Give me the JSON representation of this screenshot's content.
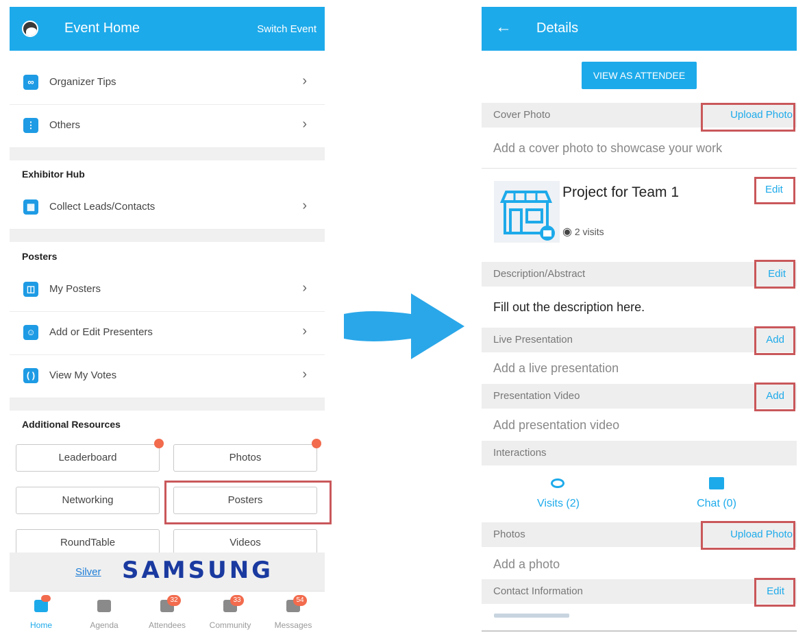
{
  "left": {
    "appbar": {
      "title": "Event Home",
      "switch": "Switch Event"
    },
    "menu_top": [
      {
        "label": "Organizer Tips",
        "icon": "glasses-icon"
      },
      {
        "label": "Others",
        "icon": "more-vertical-icon"
      }
    ],
    "exhibitor_hub": {
      "heading": "Exhibitor Hub",
      "items": [
        {
          "label": "Collect Leads/Contacts",
          "icon": "qr-code-icon"
        }
      ]
    },
    "posters": {
      "heading": "Posters",
      "items": [
        {
          "label": "My Posters",
          "icon": "poster-icon"
        },
        {
          "label": "Add or Edit Presenters",
          "icon": "presenters-icon"
        },
        {
          "label": "View My Votes",
          "icon": "laurel-icon"
        }
      ]
    },
    "resources": {
      "heading": "Additional Resources",
      "buttons": [
        "Leaderboard",
        "Photos",
        "Networking",
        "Posters",
        "RoundTable",
        "Videos"
      ]
    },
    "sponsor": {
      "tier": "Silver",
      "name": "SAMSUNG"
    },
    "tabs": [
      {
        "label": "Home",
        "badge": ""
      },
      {
        "label": "Agenda",
        "badge": ""
      },
      {
        "label": "Attendees",
        "badge": "32"
      },
      {
        "label": "Community",
        "badge": "33"
      },
      {
        "label": "Messages",
        "badge": "54"
      }
    ]
  },
  "right": {
    "appbar": {
      "title": "Details"
    },
    "view_as_attendee": "VIEW AS ATTENDEE",
    "cover_photo": {
      "label": "Cover Photo",
      "action": "Upload Photo",
      "hint": "Add a cover photo to showcase your work"
    },
    "project": {
      "title": "Project for Team 1",
      "visits": "2 visits",
      "edit": "Edit"
    },
    "description": {
      "label": "Description/Abstract",
      "action": "Edit",
      "text": "Fill out the description here."
    },
    "live": {
      "label": "Live Presentation",
      "action": "Add",
      "hint": "Add a live presentation"
    },
    "video": {
      "label": "Presentation Video",
      "action": "Add",
      "hint": "Add presentation video"
    },
    "interactions": {
      "label": "Interactions",
      "visits": "Visits (2)",
      "chat": "Chat (0)"
    },
    "photos": {
      "label": "Photos",
      "action": "Upload Photo",
      "hint": "Add a photo"
    },
    "contact": {
      "label": "Contact Information",
      "action": "Edit"
    }
  },
  "colors": {
    "primary": "#1daaea",
    "highlight": "#c9575a",
    "badge": "#f26b4d"
  }
}
